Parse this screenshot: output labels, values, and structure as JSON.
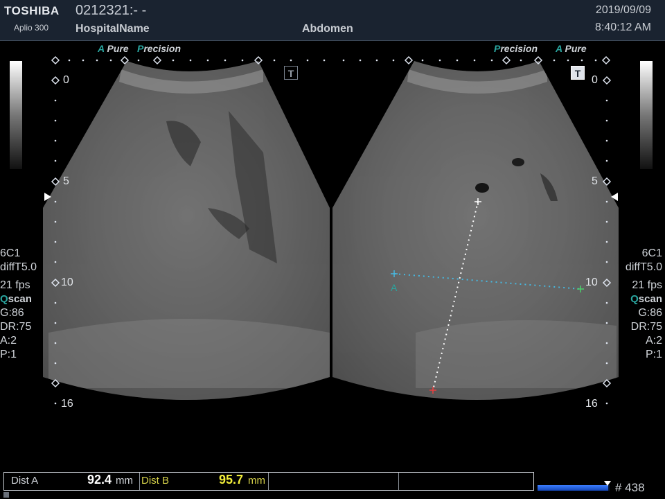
{
  "header": {
    "brand": "TOSHIBA",
    "model": "Aplio 300",
    "patient_id": "0212321:- -",
    "hospital": "HospitalName",
    "exam": "Abdomen",
    "date": "2019/09/09",
    "time": "8:40:12 AM"
  },
  "tags": {
    "left_apure_a": "A",
    "left_apure": "Pure",
    "left_precision_p": "P",
    "left_precision": "recision",
    "right_precision_p": "P",
    "right_precision": "recision",
    "right_apure_a": "A",
    "right_apure": "Pure"
  },
  "icons": {
    "toggle_left": "T",
    "toggle_right": "T"
  },
  "depth_scale": {
    "d0": "0",
    "d5": "5",
    "d10": "10",
    "d16": "16"
  },
  "params": {
    "probe": "6C1",
    "mode": "diffT5.0",
    "fps": "21 fps",
    "qscan_q": "Q",
    "qscan": "scan",
    "gain": "G:86",
    "dr": "DR:75",
    "a": "A:2",
    "p": "P:1"
  },
  "calipers": {
    "a_label": "A"
  },
  "measurements": [
    {
      "label": "Dist A",
      "value": "92.4",
      "unit": "mm"
    },
    {
      "label": "Dist B",
      "value": "95.7",
      "unit": "mm"
    }
  ],
  "cine": {
    "frame": "# 438",
    "progress": 0.98
  },
  "colors": {
    "accent_teal": "#2aa6a0",
    "dist_a_label": "#cfd3d8",
    "dist_b_label": "#d6d24a",
    "dist_b_value": "#f2ee3a",
    "caliper_a": "#47b8e0",
    "caliper_b": "#ffffff"
  }
}
